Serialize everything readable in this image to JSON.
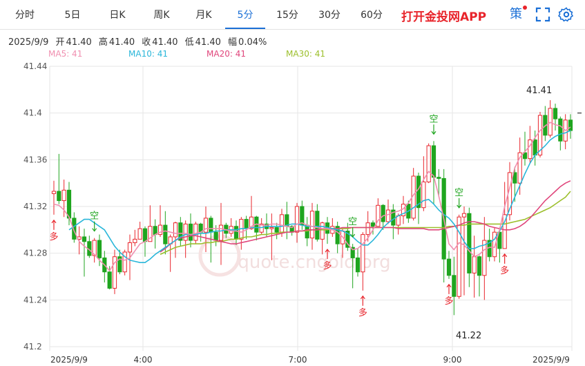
{
  "tabs": [
    {
      "label": "分时",
      "x": 52,
      "w": 44
    },
    {
      "label": "5日",
      "x": 113,
      "w": 36
    },
    {
      "label": "日K",
      "x": 173,
      "w": 36
    },
    {
      "label": "周K",
      "x": 233,
      "w": 36
    },
    {
      "label": "月K",
      "x": 294,
      "w": 36
    },
    {
      "label": "5分",
      "x": 355,
      "w": 58,
      "active": true
    },
    {
      "label": "15分",
      "x": 415,
      "w": 40
    },
    {
      "label": "30分",
      "x": 477,
      "w": 40
    },
    {
      "label": "60分",
      "x": 537,
      "w": 40
    }
  ],
  "brand": "打开金投网APP",
  "tools": {
    "strategy": "策",
    "fullscreen": "⛶",
    "settings": "⚙"
  },
  "info": {
    "date": "2025/9/9",
    "open_label": "开",
    "open": "41.40",
    "high_label": "高",
    "high": "41.40",
    "close_label": "收",
    "close": "41.40",
    "low_label": "低",
    "low": "41.40",
    "amp_label": "幅",
    "amp": "0.04%"
  },
  "ma_legend": [
    {
      "label": "MA5: 41",
      "color": "#f08fb0"
    },
    {
      "label": "MA10: 41",
      "color": "#29b6d9"
    },
    {
      "label": "MA20: 41",
      "color": "#e0457b"
    },
    {
      "label": "MA30: 41",
      "color": "#9cbf2b"
    }
  ],
  "watermark": "quote.cngold.org",
  "chart_data": {
    "type": "candlestick",
    "y_ticks": [
      "41.44",
      "41.4",
      "41.36",
      "41.32",
      "41.28",
      "41.24",
      "41.2"
    ],
    "ylim": [
      41.2,
      41.44
    ],
    "x_labels": [
      "2025/9/9",
      "4:00",
      "7:00",
      "9:00",
      "2025/9/9"
    ],
    "max_label": "41.41",
    "min_label": "41.22",
    "candles": [
      [
        41.331,
        41.333,
        41.342,
        41.313
      ],
      [
        41.333,
        41.325,
        41.365,
        41.322
      ],
      [
        41.325,
        41.334,
        41.343,
        41.311
      ],
      [
        41.334,
        41.31,
        41.341,
        41.304
      ],
      [
        41.31,
        41.292,
        41.315,
        41.289
      ],
      [
        41.292,
        41.294,
        41.303,
        41.279
      ],
      [
        41.294,
        41.29,
        41.301,
        41.26
      ],
      [
        41.29,
        41.278,
        41.295,
        41.276
      ],
      [
        41.278,
        41.291,
        41.293,
        41.272
      ],
      [
        41.291,
        41.276,
        41.296,
        41.269
      ],
      [
        41.276,
        41.264,
        41.282,
        41.255
      ],
      [
        41.264,
        41.25,
        41.269,
        41.249
      ],
      [
        41.25,
        41.277,
        41.283,
        41.245
      ],
      [
        41.277,
        41.264,
        41.283,
        41.262
      ],
      [
        41.264,
        41.281,
        41.283,
        41.261
      ],
      [
        41.281,
        41.289,
        41.296,
        41.257
      ],
      [
        41.289,
        41.292,
        41.3,
        41.286
      ],
      [
        41.292,
        41.301,
        41.307,
        41.292
      ],
      [
        41.301,
        41.29,
        41.303,
        41.277
      ],
      [
        41.29,
        41.303,
        41.321,
        41.29
      ],
      [
        41.303,
        41.296,
        41.309,
        41.284
      ],
      [
        41.296,
        41.304,
        41.321,
        41.294
      ],
      [
        41.304,
        41.288,
        41.316,
        41.279
      ],
      [
        41.288,
        41.294,
        41.296,
        41.264
      ],
      [
        41.294,
        41.306,
        41.307,
        41.276
      ],
      [
        41.306,
        41.291,
        41.311,
        41.286
      ],
      [
        41.291,
        41.305,
        41.308,
        41.276
      ],
      [
        41.305,
        41.291,
        41.314,
        41.285
      ],
      [
        41.291,
        41.305,
        41.307,
        41.288
      ],
      [
        41.305,
        41.298,
        41.306,
        41.29
      ],
      [
        41.298,
        41.31,
        41.32,
        41.281
      ],
      [
        41.31,
        41.298,
        41.312,
        41.272
      ],
      [
        41.298,
        41.291,
        41.304,
        41.286
      ],
      [
        41.291,
        41.304,
        41.323,
        41.27
      ],
      [
        41.304,
        41.297,
        41.306,
        41.293
      ],
      [
        41.297,
        41.303,
        41.31,
        41.294
      ],
      [
        41.303,
        41.292,
        41.308,
        41.287
      ],
      [
        41.292,
        41.309,
        41.311,
        41.283
      ],
      [
        41.309,
        41.301,
        41.312,
        41.292
      ],
      [
        41.301,
        41.311,
        41.329,
        41.3
      ],
      [
        41.311,
        41.298,
        41.312,
        41.291
      ],
      [
        41.298,
        41.305,
        41.31,
        41.296
      ],
      [
        41.305,
        41.301,
        41.314,
        41.294
      ],
      [
        41.301,
        41.302,
        41.314,
        41.274
      ],
      [
        41.302,
        41.298,
        41.306,
        41.292
      ],
      [
        41.298,
        41.313,
        41.318,
        41.294
      ],
      [
        41.313,
        41.303,
        41.324,
        41.292
      ],
      [
        41.303,
        41.298,
        41.304,
        41.295
      ],
      [
        41.298,
        41.32,
        41.323,
        41.289
      ],
      [
        41.32,
        41.304,
        41.325,
        41.3
      ],
      [
        41.304,
        41.293,
        41.311,
        41.286
      ],
      [
        41.293,
        41.316,
        41.323,
        41.283
      ],
      [
        41.316,
        41.292,
        41.322,
        41.29
      ],
      [
        41.292,
        41.306,
        41.307,
        41.279
      ],
      [
        41.306,
        41.297,
        41.311,
        41.288
      ],
      [
        41.297,
        41.303,
        41.31,
        41.294
      ],
      [
        41.303,
        41.288,
        41.307,
        41.28
      ],
      [
        41.288,
        41.299,
        41.301,
        41.276
      ],
      [
        41.299,
        41.285,
        41.306,
        41.282
      ],
      [
        41.285,
        41.276,
        41.288,
        41.25
      ],
      [
        41.276,
        41.264,
        41.284,
        41.26
      ],
      [
        41.264,
        41.296,
        41.298,
        41.248
      ],
      [
        41.296,
        41.306,
        41.316,
        41.29
      ],
      [
        41.306,
        41.303,
        41.308,
        41.296
      ],
      [
        41.303,
        41.321,
        41.327,
        41.303
      ],
      [
        41.321,
        41.307,
        41.322,
        41.3
      ],
      [
        41.307,
        41.317,
        41.326,
        41.305
      ],
      [
        41.317,
        41.304,
        41.322,
        41.292
      ],
      [
        41.304,
        41.312,
        41.314,
        41.296
      ],
      [
        41.312,
        41.322,
        41.329,
        41.305
      ],
      [
        41.322,
        41.31,
        41.325,
        41.306
      ],
      [
        41.31,
        41.346,
        41.353,
        41.308
      ],
      [
        41.346,
        41.319,
        41.349,
        41.305
      ],
      [
        41.319,
        41.341,
        41.363,
        41.316
      ],
      [
        41.341,
        41.372,
        41.374,
        41.34
      ],
      [
        41.372,
        41.345,
        41.376,
        41.322
      ],
      [
        41.345,
        41.344,
        41.352,
        41.328
      ],
      [
        41.344,
        41.275,
        41.352,
        41.255
      ],
      [
        41.275,
        41.261,
        41.282,
        41.258
      ],
      [
        41.261,
        41.243,
        41.277,
        41.227
      ],
      [
        41.243,
        41.311,
        41.313,
        41.241
      ],
      [
        41.311,
        41.314,
        41.32,
        41.244
      ],
      [
        41.314,
        41.263,
        41.319,
        41.251
      ],
      [
        41.263,
        41.277,
        41.295,
        41.242
      ],
      [
        41.277,
        41.261,
        41.278,
        41.243
      ],
      [
        41.261,
        41.291,
        41.311,
        41.24
      ],
      [
        41.291,
        41.277,
        41.301,
        41.273
      ],
      [
        41.277,
        41.298,
        41.302,
        41.273
      ],
      [
        41.298,
        41.284,
        41.302,
        41.272
      ],
      [
        41.284,
        41.313,
        41.341,
        41.284
      ],
      [
        41.313,
        41.349,
        41.358,
        41.308
      ],
      [
        41.349,
        41.34,
        41.354,
        41.324
      ],
      [
        41.34,
        41.366,
        41.379,
        41.33
      ],
      [
        41.366,
        41.361,
        41.384,
        41.355
      ],
      [
        41.361,
        41.377,
        41.389,
        41.357
      ],
      [
        41.377,
        41.364,
        41.385,
        41.355
      ],
      [
        41.364,
        41.398,
        41.401,
        41.362
      ],
      [
        41.398,
        41.381,
        41.406,
        41.376
      ],
      [
        41.381,
        41.404,
        41.411,
        41.379
      ],
      [
        41.404,
        41.395,
        41.408,
        41.385
      ],
      [
        41.395,
        41.376,
        41.397,
        41.368
      ],
      [
        41.376,
        41.394,
        41.399,
        41.369
      ],
      [
        41.394,
        41.385,
        41.399,
        41.378
      ]
    ],
    "ma5": [
      41.322,
      41.321,
      41.317,
      41.311,
      41.299,
      41.29,
      41.286,
      41.283,
      41.279,
      41.274,
      41.27,
      41.265,
      41.272,
      41.275,
      41.274,
      41.276,
      41.282,
      41.288,
      41.29,
      41.293,
      41.296,
      41.298,
      41.299,
      41.298,
      41.297,
      41.297,
      41.297,
      41.296,
      41.297,
      41.298,
      41.301,
      41.301,
      41.301,
      41.301,
      41.3,
      41.299,
      41.299,
      41.298,
      41.3,
      41.303,
      41.305,
      41.304,
      41.304,
      41.305,
      41.305,
      41.304,
      41.303,
      41.302,
      41.305,
      41.306,
      41.304,
      41.303,
      41.302,
      41.301,
      41.301,
      41.3,
      41.298,
      41.294,
      41.288,
      41.283,
      41.284,
      41.288,
      41.293,
      41.3,
      41.308,
      41.312,
      41.313,
      41.315,
      41.316,
      41.318,
      41.323,
      41.33,
      41.335,
      41.343,
      41.35,
      41.346,
      41.329,
      41.309,
      41.288,
      41.283,
      41.289,
      41.287,
      41.282,
      41.277,
      41.279,
      41.283,
      41.285,
      41.285,
      41.3,
      41.32,
      41.336,
      41.353,
      41.362,
      41.367,
      41.372,
      41.379,
      41.385,
      41.389,
      41.392,
      41.39,
      41.389,
      41.385,
      41.388
    ],
    "ma10": [
      41.3,
      41.303,
      41.306,
      41.309,
      41.309,
      41.306,
      41.303,
      41.3,
      41.293,
      41.286,
      41.281,
      41.277,
      41.274,
      41.273,
      41.272,
      41.272,
      41.275,
      41.279,
      41.282,
      41.285,
      41.288,
      41.291,
      41.294,
      41.296,
      41.296,
      41.296,
      41.297,
      41.297,
      41.298,
      41.299,
      41.299,
      41.3,
      41.3,
      41.3,
      41.301,
      41.301,
      41.302,
      41.302,
      41.302,
      41.303,
      41.303,
      41.303,
      41.303,
      41.304,
      41.305,
      41.305,
      41.304,
      41.303,
      41.303,
      41.303,
      41.303,
      41.302,
      41.301,
      41.3,
      41.299,
      41.297,
      41.294,
      41.29,
      41.287,
      41.287,
      41.291,
      41.296,
      41.302,
      41.306,
      41.309,
      41.312,
      41.314,
      41.316,
      41.319,
      41.322,
      41.325,
      41.326,
      41.322,
      41.317,
      41.313,
      41.31,
      41.305,
      41.298,
      41.29,
      41.284,
      41.284,
      41.286,
      41.287,
      41.289,
      41.292,
      41.299,
      41.307,
      41.318,
      41.328,
      41.338,
      41.348,
      41.357,
      41.364,
      41.368,
      41.372,
      41.377,
      41.38,
      41.382,
      41.383,
      41.385
    ],
    "ma20": [
      41.281,
      41.284,
      41.288,
      41.291,
      41.293,
      41.294,
      41.295,
      41.295,
      41.294,
      41.293,
      41.292,
      41.291,
      41.29,
      41.289,
      41.288,
      41.288,
      41.289,
      41.29,
      41.291,
      41.292,
      41.293,
      41.294,
      41.295,
      41.296,
      41.297,
      41.298,
      41.298,
      41.299,
      41.299,
      41.3,
      41.3,
      41.3,
      41.301,
      41.301,
      41.301,
      41.301,
      41.302,
      41.302,
      41.302,
      41.302,
      41.302,
      41.302,
      41.302,
      41.302,
      41.302,
      41.302,
      41.302,
      41.301,
      41.301,
      41.301,
      41.301,
      41.301,
      41.301,
      41.3,
      41.3,
      41.3,
      41.301,
      41.302,
      41.303,
      41.304,
      41.306,
      41.307,
      41.307,
      41.306,
      41.305,
      41.303,
      41.302,
      41.301,
      41.3,
      41.3,
      41.301,
      41.303,
      41.306,
      41.31,
      41.315,
      41.32,
      41.325,
      41.329,
      41.333,
      41.337,
      41.34,
      41.342
    ],
    "ma30": [
      41.279,
      41.281,
      41.283,
      41.285,
      41.286,
      41.287,
      41.288,
      41.288,
      41.288,
      41.289,
      41.289,
      41.29,
      41.29,
      41.291,
      41.292,
      41.292,
      41.293,
      41.294,
      41.294,
      41.295,
      41.296,
      41.296,
      41.297,
      41.297,
      41.298,
      41.298,
      41.298,
      41.299,
      41.299,
      41.299,
      41.3,
      41.3,
      41.3,
      41.3,
      41.301,
      41.301,
      41.301,
      41.301,
      41.302,
      41.302,
      41.302,
      41.302,
      41.302,
      41.302,
      41.302,
      41.302,
      41.302,
      41.302,
      41.302,
      41.302,
      41.302,
      41.302,
      41.302,
      41.302,
      41.302,
      41.302,
      41.302,
      41.303,
      41.303,
      41.304,
      41.304,
      41.305,
      41.305,
      41.305,
      41.305,
      41.305,
      41.305,
      41.305,
      41.305,
      41.306,
      41.307,
      41.308,
      41.309,
      41.311,
      41.313,
      41.315,
      41.317,
      41.319,
      41.322,
      41.325,
      41.328,
      41.333
    ],
    "signals": [
      {
        "type": "buy",
        "label": "多",
        "index": 0
      },
      {
        "type": "sell",
        "label": "空",
        "index": 8
      },
      {
        "type": "buy",
        "label": "多",
        "index": 54
      },
      {
        "type": "sell",
        "label": "空",
        "index": 59
      },
      {
        "type": "buy",
        "label": "多",
        "index": 61
      },
      {
        "type": "sell",
        "label": "空",
        "index": 75
      },
      {
        "type": "buy",
        "label": "多",
        "index": 78
      },
      {
        "type": "sell",
        "label": "空",
        "index": 80
      },
      {
        "type": "buy",
        "label": "多",
        "index": 89
      }
    ]
  }
}
